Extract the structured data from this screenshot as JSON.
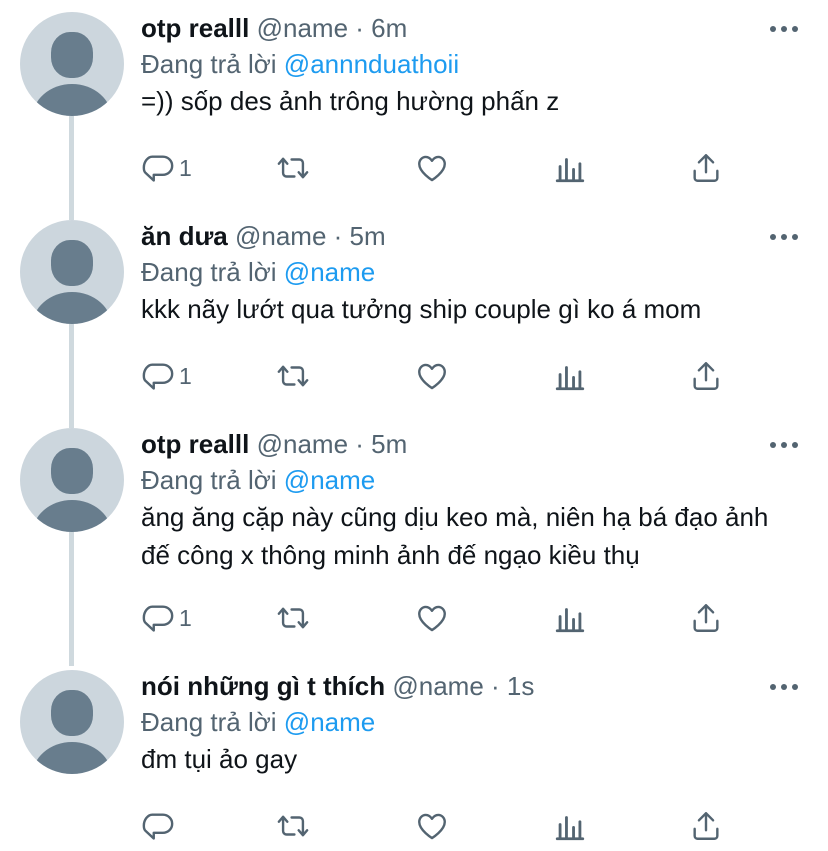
{
  "colors": {
    "accent": "#1d9bf0",
    "secondary_text": "#536471",
    "thread_line": "#cfd9de"
  },
  "tweets": [
    {
      "display_name": "otp realll",
      "handle": "@name",
      "separator": "·",
      "time": "6m",
      "reply_prefix": "Đang trả lời",
      "reply_to": "@annnduathoii",
      "text": "=)) sốp des ảnh trông hường phấn z",
      "reply_count": "1"
    },
    {
      "display_name": "ăn dưa",
      "handle": "@name",
      "separator": "·",
      "time": "5m",
      "reply_prefix": "Đang trả lời",
      "reply_to": "@name",
      "text": "kkk nãy lướt qua tưởng ship couple gì ko á mom",
      "reply_count": "1"
    },
    {
      "display_name": "otp realll",
      "handle": "@name",
      "separator": "·",
      "time": "5m",
      "reply_prefix": "Đang trả lời",
      "reply_to": "@name",
      "text": "ăng ăng cặp này cũng dịu keo mà, niên hạ bá đạo ảnh đế công x thông minh ảnh đế ngạo kiều thụ",
      "reply_count": "1"
    },
    {
      "display_name": "nói những gì t thích",
      "handle": "@name",
      "separator": "·",
      "time": "1s",
      "reply_prefix": "Đang trả lời",
      "reply_to": "@name",
      "text": "đm tụi ảo gay",
      "reply_count": ""
    }
  ],
  "icons": [
    "reply-icon",
    "retweet-icon",
    "like-icon",
    "analytics-icon",
    "share-icon",
    "more-icon"
  ]
}
